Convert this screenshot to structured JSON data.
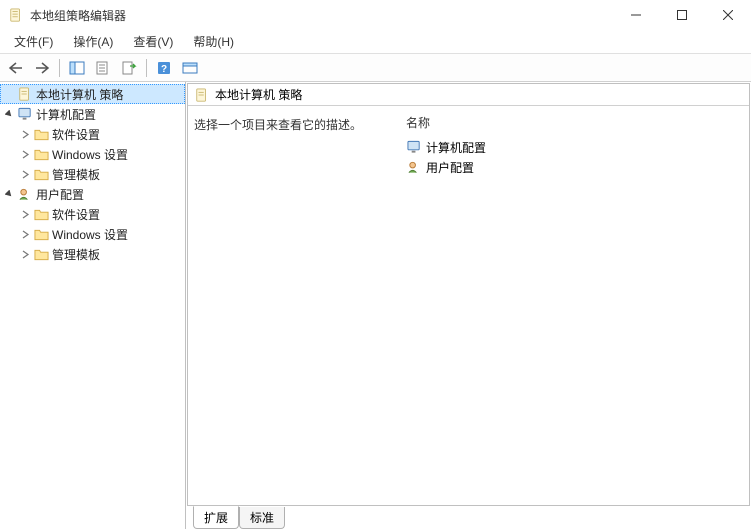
{
  "window": {
    "title": "本地组策略编辑器"
  },
  "menu": {
    "file": "文件(F)",
    "action": "操作(A)",
    "view": "查看(V)",
    "help": "帮助(H)"
  },
  "tree": {
    "root": {
      "label": "本地计算机 策略"
    },
    "computer": {
      "label": "计算机配置"
    },
    "user": {
      "label": "用户配置"
    },
    "software": {
      "label": "软件设置"
    },
    "windows": {
      "label": "Windows 设置"
    },
    "admin": {
      "label": "管理模板"
    }
  },
  "details": {
    "headerTitle": "本地计算机 策略",
    "description": "选择一个项目来查看它的描述。",
    "columnName": "名称",
    "items": [
      {
        "label": "计算机配置"
      },
      {
        "label": "用户配置"
      }
    ]
  },
  "tabs": {
    "extended": "扩展",
    "standard": "标准"
  }
}
